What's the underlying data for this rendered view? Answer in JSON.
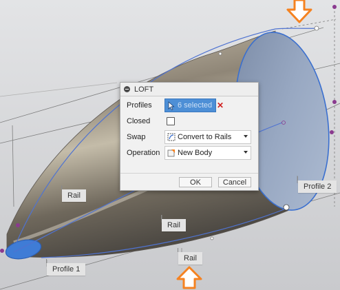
{
  "dialog": {
    "title": "LOFT",
    "profiles_label": "Profiles",
    "profiles_value": "6 selected",
    "closed_label": "Closed",
    "closed_checked": false,
    "swap_label": "Swap",
    "swap_value": "Convert to Rails",
    "operation_label": "Operation",
    "operation_value": "New Body",
    "ok_label": "OK",
    "cancel_label": "Cancel"
  },
  "viewport_tags": {
    "rail_1": "Rail",
    "rail_2": "Rail",
    "rail_3": "Rail",
    "profile_1": "Profile 1",
    "profile_2": "Profile 2"
  },
  "colors": {
    "selection_blue": "#4d8fd6",
    "annotation_orange": "#f58220",
    "sketch_purple": "#8a3a8f",
    "clear_red": "#d01e1e"
  }
}
